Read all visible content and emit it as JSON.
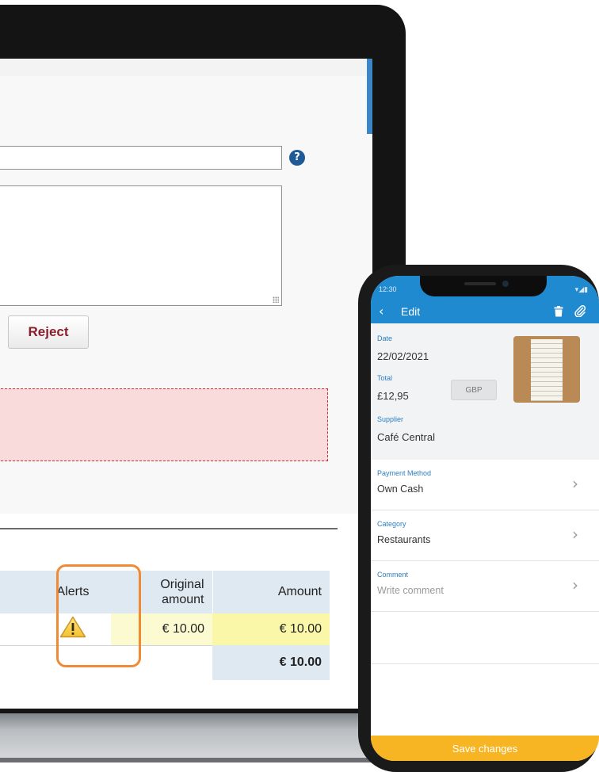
{
  "laptop": {
    "help_icon": "?",
    "reject_label": "Reject",
    "table": {
      "headers": {
        "alerts": "Alerts",
        "original_amount_line1": "Original",
        "original_amount_line2": "amount",
        "amount": "Amount"
      },
      "rows": [
        {
          "original_amount": "€ 10.00",
          "amount": "€ 10.00",
          "alert_icon": "warning-icon"
        }
      ],
      "total": "€ 10.00"
    },
    "colors": {
      "reject_text": "#8a1f2c",
      "error_box": "#fadbdb",
      "highlight": "#f08a35",
      "table_header": "#dfe9f2"
    }
  },
  "phone": {
    "status_time": "12:30",
    "status_icons": "▾◢▮",
    "back_icon": "‹",
    "title": "Edit",
    "date_label": "Date",
    "date_value": "22/02/2021",
    "total_label": "Total",
    "total_value": "£12,95",
    "currency": "GBP",
    "supplier_label": "Supplier",
    "supplier_value": "Café Central",
    "payment_label": "Payment Method",
    "payment_value": "Own Cash",
    "category_label": "Category",
    "category_value": "Restaurants",
    "comment_label": "Comment",
    "comment_placeholder": "Write comment",
    "chevron": "›",
    "save_label": "Save changes",
    "colors": {
      "header": "#1f8ad0",
      "save_bar": "#f7b524",
      "label": "#2b7fc2"
    }
  }
}
